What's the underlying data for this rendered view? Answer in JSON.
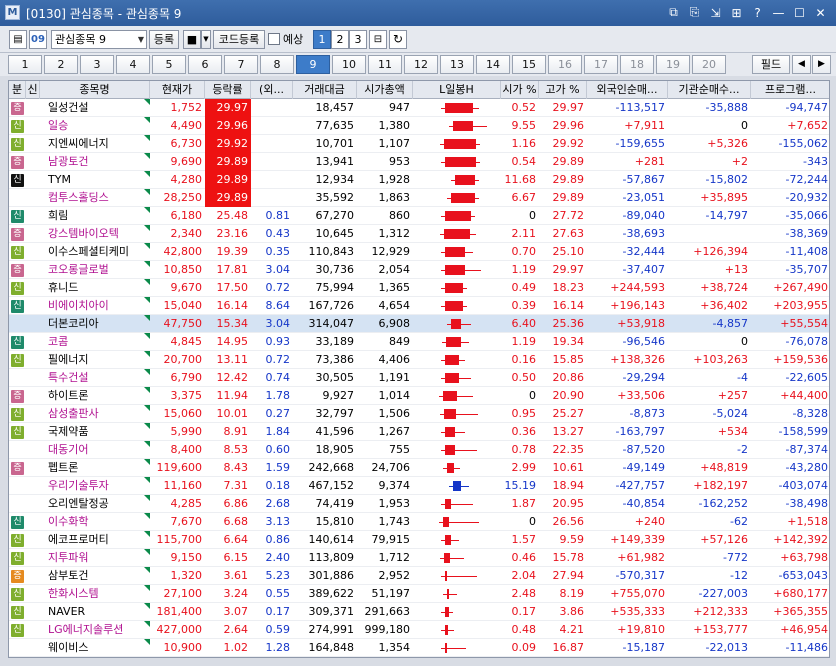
{
  "window": {
    "app_icon": "M",
    "title": "[0130] 관심종목 - 관심종목 9"
  },
  "toolbar": {
    "group_select": "관심종목 9",
    "register_label": "등록",
    "code_register_label": "코드등록",
    "reserve_label": "예상",
    "pages": [
      "1",
      "2",
      "3"
    ],
    "active_page": "1",
    "zoom_icon": "09"
  },
  "tabs": {
    "items": [
      "1",
      "2",
      "3",
      "4",
      "5",
      "6",
      "7",
      "8",
      "9",
      "10",
      "11",
      "12",
      "13",
      "14",
      "15",
      "16",
      "17",
      "18",
      "19",
      "20"
    ],
    "active": "9",
    "filter_label": "필드"
  },
  "columns": [
    "분",
    "신",
    "종목명",
    "현재가",
    "등락률",
    "(외...",
    "거래대금",
    "시가총액",
    "L일봉H",
    "시가 %",
    "고가 %",
    "외국인순매...",
    "기관순매수...",
    "프로그램..."
  ],
  "rows": [
    {
      "badge": "증",
      "bc": "b-jeung",
      "name": "일성건설",
      "price": "1,752",
      "rate": "29.97",
      "rhl": true,
      "foreign_ratio": "",
      "vol": "18,457",
      "cap": "947",
      "open": "0.52",
      "high": "29.97",
      "frn": "-113,517",
      "inst": "-35,888",
      "prog": "-94,747",
      "candle": [
        32,
        28,
        2
      ]
    },
    {
      "badge": "신",
      "bc": "b-sin2",
      "name": "일승",
      "price": "4,490",
      "rate": "29.96",
      "rhl": true,
      "foreign_ratio": "",
      "vol": "77,635",
      "cap": "1,380",
      "open": "9.55",
      "high": "29.96",
      "frn": "+7,911",
      "inst": "0",
      "prog": "+7,652",
      "candle": [
        40,
        20,
        10
      ]
    },
    {
      "badge": "신",
      "bc": "b-sin2",
      "name": "지엔씨에너지",
      "price": "6,730",
      "rate": "29.92",
      "rhl": true,
      "foreign_ratio": "",
      "vol": "10,701",
      "cap": "1,107",
      "open": "1.16",
      "high": "29.92",
      "frn": "-159,655",
      "inst": "+5,326",
      "prog": "-155,062",
      "candle": [
        31,
        32,
        0
      ]
    },
    {
      "badge": "증",
      "bc": "b-jeung",
      "name": "남광토건",
      "price": "9,690",
      "rate": "29.89",
      "rhl": true,
      "foreign_ratio": "",
      "vol": "13,941",
      "cap": "953",
      "open": "0.54",
      "high": "29.89",
      "frn": "+281",
      "inst": "+2",
      "prog": "-343",
      "candle": [
        32,
        31,
        0
      ]
    },
    {
      "badge": "신",
      "bc": "b-blk",
      "name": "TYM",
      "price": "4,280",
      "rate": "29.89",
      "rhl": true,
      "foreign_ratio": "",
      "vol": "12,934",
      "cap": "1,928",
      "open": "11.68",
      "high": "29.89",
      "frn": "-57,867",
      "inst": "-15,802",
      "prog": "-72,244",
      "candle": [
        42,
        20,
        0
      ]
    },
    {
      "badge": "",
      "bc": "",
      "name": "컴투스홀딩스",
      "price": "28,250",
      "rate": "29.89",
      "rhl": true,
      "foreign_ratio": "",
      "vol": "35,592",
      "cap": "1,863",
      "open": "6.67",
      "high": "29.89",
      "frn": "-23,051",
      "inst": "+35,895",
      "prog": "-20,932",
      "candle": [
        38,
        24,
        0
      ]
    },
    {
      "badge": "신",
      "bc": "b-sin",
      "name": "희림",
      "price": "6,180",
      "rate": "25.48",
      "rhl": false,
      "foreign_ratio": "0.81",
      "vol": "67,270",
      "cap": "860",
      "open": "0",
      "high": "27.72",
      "frn": "-89,040",
      "inst": "-14,797",
      "prog": "-35,066",
      "candle": [
        32,
        26,
        0
      ]
    },
    {
      "badge": "증",
      "bc": "b-jeung",
      "name": "강스템바이오텍",
      "price": "2,340",
      "rate": "23.16",
      "rhl": false,
      "foreign_ratio": "0.43",
      "vol": "10,645",
      "cap": "1,312",
      "open": "2.11",
      "high": "27.63",
      "frn": "-38,693",
      "inst": "",
      "prog": "-38,369",
      "candle": [
        31,
        26,
        2
      ]
    },
    {
      "badge": "신",
      "bc": "b-sin2",
      "name": "이수스페셜티케미",
      "price": "42,800",
      "rate": "19.39",
      "rhl": false,
      "foreign_ratio": "0.35",
      "vol": "110,843",
      "cap": "12,929",
      "open": "0.70",
      "high": "25.10",
      "frn": "-32,444",
      "inst": "+126,394",
      "prog": "-11,408",
      "candle": [
        32,
        20,
        4
      ]
    },
    {
      "badge": "증",
      "bc": "b-jeung",
      "name": "코오롱글로벌",
      "price": "10,850",
      "rate": "17.81",
      "rhl": false,
      "foreign_ratio": "3.04",
      "vol": "30,736",
      "cap": "2,054",
      "open": "1.19",
      "high": "29.97",
      "frn": "-37,407",
      "inst": "+13",
      "prog": "-35,707",
      "candle": [
        32,
        20,
        12
      ]
    },
    {
      "badge": "신",
      "bc": "b-sin2",
      "name": "휴니드",
      "price": "9,670",
      "rate": "17.50",
      "rhl": false,
      "foreign_ratio": "0.72",
      "vol": "75,994",
      "cap": "1,365",
      "open": "0.49",
      "high": "18.23",
      "frn": "+244,593",
      "inst": "+38,724",
      "prog": "+267,490",
      "candle": [
        32,
        18,
        0
      ]
    },
    {
      "badge": "신",
      "bc": "b-sin",
      "name": "비에이치아이",
      "price": "15,040",
      "rate": "16.14",
      "rhl": false,
      "foreign_ratio": "8.64",
      "vol": "167,726",
      "cap": "4,654",
      "open": "0.39",
      "high": "16.14",
      "frn": "+196,143",
      "inst": "+36,402",
      "prog": "+203,955",
      "candle": [
        32,
        18,
        0
      ]
    },
    {
      "badge": "",
      "bc": "",
      "name": "더본코리아",
      "price": "47,750",
      "rate": "15.34",
      "rhl": false,
      "foreign_ratio": "3.04",
      "vol": "314,047",
      "cap": "6,908",
      "open": "6.40",
      "high": "25.36",
      "frn": "+53,918",
      "inst": "-4,857",
      "prog": "+55,554",
      "candle": [
        38,
        10,
        6
      ],
      "hl": true
    },
    {
      "badge": "신",
      "bc": "b-sin",
      "name": "코콤",
      "price": "4,845",
      "rate": "14.95",
      "rhl": false,
      "foreign_ratio": "0.93",
      "vol": "33,189",
      "cap": "849",
      "open": "1.19",
      "high": "19.34",
      "frn": "-96,546",
      "inst": "0",
      "prog": "-76,078",
      "candle": [
        33,
        15,
        4
      ]
    },
    {
      "badge": "신",
      "bc": "b-sin2",
      "name": "필에너지",
      "price": "20,700",
      "rate": "13.11",
      "rhl": false,
      "foreign_ratio": "0.72",
      "vol": "73,386",
      "cap": "4,406",
      "open": "0.16",
      "high": "15.85",
      "frn": "+138,326",
      "inst": "+103,263",
      "prog": "+159,536",
      "candle": [
        32,
        14,
        2
      ]
    },
    {
      "badge": "",
      "bc": "",
      "name": "특수건설",
      "price": "6,790",
      "rate": "12.42",
      "rhl": false,
      "foreign_ratio": "0.74",
      "vol": "30,505",
      "cap": "1,191",
      "open": "0.50",
      "high": "20.86",
      "frn": "-29,294",
      "inst": "-4",
      "prog": "-22,605",
      "candle": [
        32,
        14,
        8
      ]
    },
    {
      "badge": "증",
      "bc": "b-jeung",
      "name": "하이트론",
      "price": "3,375",
      "rate": "11.94",
      "rhl": false,
      "foreign_ratio": "1.78",
      "vol": "9,927",
      "cap": "1,014",
      "open": "0",
      "high": "20.90",
      "frn": "+33,506",
      "inst": "+257",
      "prog": "+44,400",
      "candle": [
        30,
        14,
        12
      ]
    },
    {
      "badge": "신",
      "bc": "b-sin2",
      "name": "삼성출판사",
      "price": "15,060",
      "rate": "10.01",
      "rhl": false,
      "foreign_ratio": "0.27",
      "vol": "32,797",
      "cap": "1,506",
      "open": "0.95",
      "high": "25.27",
      "frn": "-8,873",
      "inst": "-5,024",
      "prog": "-8,328",
      "candle": [
        31,
        12,
        18
      ]
    },
    {
      "badge": "신",
      "bc": "b-sin2",
      "name": "국제약품",
      "price": "5,990",
      "rate": "8.91",
      "rhl": false,
      "foreign_ratio": "1.84",
      "vol": "41,596",
      "cap": "1,267",
      "open": "0.36",
      "high": "13.27",
      "frn": "-163,797",
      "inst": "+534",
      "prog": "-158,599",
      "candle": [
        32,
        10,
        6
      ]
    },
    {
      "badge": "",
      "bc": "",
      "name": "대동기어",
      "price": "8,400",
      "rate": "8.53",
      "rhl": false,
      "foreign_ratio": "0.60",
      "vol": "18,905",
      "cap": "755",
      "open": "0.78",
      "high": "22.35",
      "frn": "-87,520",
      "inst": "-2",
      "prog": "-87,374",
      "candle": [
        32,
        10,
        18
      ]
    },
    {
      "badge": "증",
      "bc": "b-jeung",
      "name": "펩트론",
      "price": "119,600",
      "rate": "8.43",
      "rhl": false,
      "foreign_ratio": "1.59",
      "vol": "242,668",
      "cap": "24,706",
      "open": "2.99",
      "high": "10.61",
      "frn": "-49,149",
      "inst": "+48,819",
      "prog": "-43,280",
      "candle": [
        34,
        7,
        2
      ]
    },
    {
      "badge": "",
      "bc": "",
      "name": "우리기술투자",
      "price": "11,160",
      "rate": "7.31",
      "rhl": false,
      "foreign_ratio": "0.18",
      "vol": "467,152",
      "cap": "9,374",
      "open": "15.19",
      "high": "18.94",
      "frn": "-427,757",
      "inst": "+182,197",
      "prog": "-403,074",
      "candle": [
        40,
        8,
        4
      ],
      "blue": true
    },
    {
      "badge": "",
      "bc": "",
      "name": "오리엔탈정공",
      "price": "4,285",
      "rate": "6.86",
      "rhl": false,
      "foreign_ratio": "2.68",
      "vol": "74,419",
      "cap": "1,953",
      "open": "1.87",
      "high": "20.95",
      "frn": "-40,854",
      "inst": "-162,252",
      "prog": "-38,498",
      "candle": [
        32,
        6,
        18
      ]
    },
    {
      "badge": "신",
      "bc": "b-sin",
      "name": "이수화학",
      "price": "7,670",
      "rate": "6.68",
      "rhl": false,
      "foreign_ratio": "3.13",
      "vol": "15,810",
      "cap": "1,743",
      "open": "0",
      "high": "26.56",
      "frn": "+240",
      "inst": "-62",
      "prog": "+1,518",
      "candle": [
        30,
        6,
        26
      ]
    },
    {
      "badge": "신",
      "bc": "b-sin2",
      "name": "에코프로머티",
      "price": "115,700",
      "rate": "6.64",
      "rhl": false,
      "foreign_ratio": "0.86",
      "vol": "140,614",
      "cap": "79,915",
      "open": "1.57",
      "high": "9.59",
      "frn": "+149,339",
      "inst": "+57,126",
      "prog": "+142,392",
      "candle": [
        32,
        6,
        4
      ]
    },
    {
      "badge": "신",
      "bc": "b-sin2",
      "name": "지투파워",
      "price": "9,150",
      "rate": "6.15",
      "rhl": false,
      "foreign_ratio": "2.40",
      "vol": "113,809",
      "cap": "1,712",
      "open": "0.46",
      "high": "15.78",
      "frn": "+61,982",
      "inst": "-772",
      "prog": "+63,798",
      "candle": [
        31,
        6,
        10
      ]
    },
    {
      "badge": "증",
      "bc": "b-ora",
      "name": "삼부토건",
      "price": "1,320",
      "rate": "3.61",
      "rhl": false,
      "foreign_ratio": "5.23",
      "vol": "301,886",
      "cap": "2,952",
      "open": "2.04",
      "high": "27.94",
      "frn": "-570,317",
      "inst": "-12",
      "prog": "-653,043",
      "candle": [
        32,
        2,
        26
      ]
    },
    {
      "badge": "신",
      "bc": "b-sin2",
      "name": "한화시스템",
      "price": "27,100",
      "rate": "3.24",
      "rhl": false,
      "foreign_ratio": "0.55",
      "vol": "389,622",
      "cap": "51,197",
      "open": "2.48",
      "high": "8.19",
      "frn": "+755,070",
      "inst": "-227,003",
      "prog": "+680,177",
      "candle": [
        34,
        2,
        4
      ]
    },
    {
      "badge": "신",
      "bc": "b-sin2",
      "name": "NAVER",
      "price": "181,400",
      "rate": "3.07",
      "rhl": false,
      "foreign_ratio": "0.17",
      "vol": "309,371",
      "cap": "291,663",
      "open": "0.17",
      "high": "3.86",
      "frn": "+535,333",
      "inst": "+212,333",
      "prog": "+365,355",
      "candle": [
        32,
        4,
        0
      ]
    },
    {
      "badge": "신",
      "bc": "b-sin2",
      "name": "LG에너지솔루션",
      "price": "427,000",
      "rate": "2.64",
      "rhl": false,
      "foreign_ratio": "0.59",
      "vol": "274,991",
      "cap": "999,180",
      "open": "0.48",
      "high": "4.21",
      "frn": "+19,810",
      "inst": "+153,777",
      "prog": "+46,954",
      "candle": [
        32,
        3,
        2
      ]
    },
    {
      "badge": "",
      "bc": "",
      "name": "웨이비스",
      "price": "10,900",
      "rate": "1.02",
      "rhl": false,
      "foreign_ratio": "1.28",
      "vol": "164,848",
      "cap": "1,354",
      "open": "0.09",
      "high": "16.87",
      "frn": "-15,187",
      "inst": "-22,013",
      "prog": "-11,486",
      "candle": [
        32,
        1,
        16
      ]
    }
  ]
}
